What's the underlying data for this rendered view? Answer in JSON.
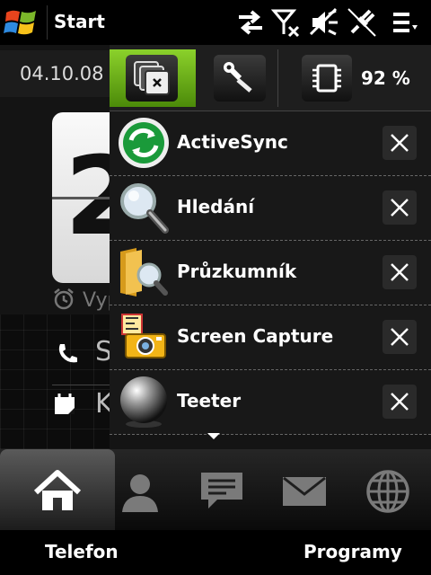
{
  "status_bar": {
    "title": "Start",
    "icons": [
      "windows-start-icon",
      "data-transfer-icon",
      "no-signal-icon",
      "speaker-muted-icon",
      "power-plug-icon",
      "menu-icon"
    ]
  },
  "home_background": {
    "date": "04.10.08",
    "clock_digit": "2",
    "alarm_text": "Vyp",
    "row1_text": "S",
    "row2_text": "K"
  },
  "task_manager": {
    "toolbar": {
      "memory_percent": "92 %",
      "buttons": [
        "running-programs-icon",
        "tools-icon",
        "memory-chip-icon"
      ]
    },
    "programs": [
      {
        "label": "ActiveSync",
        "icon": "activesync-icon"
      },
      {
        "label": "Hledání",
        "icon": "search-magnifier-icon"
      },
      {
        "label": "Průzkumník",
        "icon": "file-explorer-icon"
      },
      {
        "label": "Screen Capture",
        "icon": "screen-capture-camera-icon"
      },
      {
        "label": "Teeter",
        "icon": "teeter-ball-icon"
      }
    ]
  },
  "tabs": [
    "home-icon",
    "contacts-icon",
    "messages-icon",
    "mail-icon",
    "internet-globe-icon"
  ],
  "softkeys": {
    "left": "Telefon",
    "right": "Programy"
  },
  "colors": {
    "accent": "#6cb119",
    "background": "#000000"
  }
}
